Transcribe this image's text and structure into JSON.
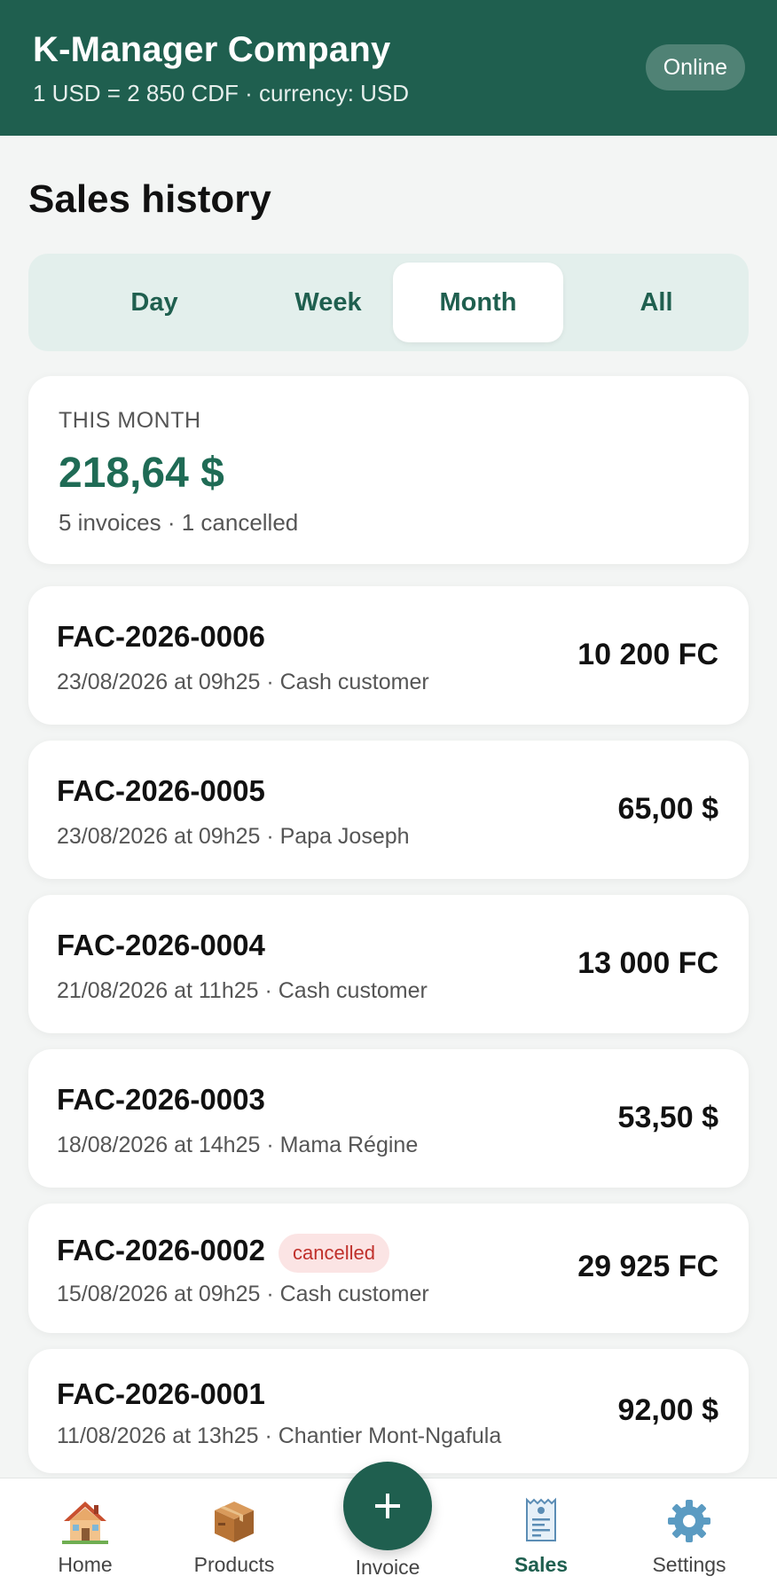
{
  "header": {
    "title": "K-Manager Company",
    "subtitle": "1 USD = 2 850 CDF · currency: USD",
    "status": "Online"
  },
  "page": {
    "title": "Sales history"
  },
  "period_tabs": {
    "items": [
      "Day",
      "Week",
      "Month",
      "All"
    ],
    "selected": "Month"
  },
  "summary": {
    "label": "THIS MONTH",
    "total": "218,64 $",
    "meta": "5 invoices · 1 cancelled"
  },
  "invoices": [
    {
      "number": "FAC-2026-0006",
      "details": "23/08/2026 at 09h25 · Cash customer",
      "amount": "10 200 FC"
    },
    {
      "number": "FAC-2026-0005",
      "details": "23/08/2026 at 09h25 · Papa Joseph",
      "amount": "65,00 $"
    },
    {
      "number": "FAC-2026-0004",
      "details": "21/08/2026 at 11h25 · Cash customer",
      "amount": "13 000 FC"
    },
    {
      "number": "FAC-2026-0003",
      "details": "18/08/2026 at 14h25 · Mama Régine",
      "amount": "53,50 $"
    },
    {
      "number": "FAC-2026-0002",
      "details": "15/08/2026 at 09h25 · Cash customer",
      "amount": "29 925 FC",
      "badge": "cancelled"
    },
    {
      "number": "FAC-2026-0001",
      "details": "11/08/2026 at 13h25 · Chantier Mont-Ngafula",
      "amount": "92,00 $"
    }
  ],
  "nav": {
    "home": {
      "label": "Home",
      "icon": "house-icon"
    },
    "products": {
      "label": "Products",
      "icon": "package-icon"
    },
    "invoice": {
      "label": "Invoice",
      "icon": "plus-icon"
    },
    "sales": {
      "label": "Sales",
      "icon": "receipt-icon"
    },
    "settings": {
      "label": "Settings",
      "icon": "gear-icon"
    }
  },
  "colors": {
    "brand": "#1f5f4f",
    "total": "#1f6b55",
    "cancelled_bg": "#fbe4e4",
    "cancelled_text": "#c0302b"
  }
}
